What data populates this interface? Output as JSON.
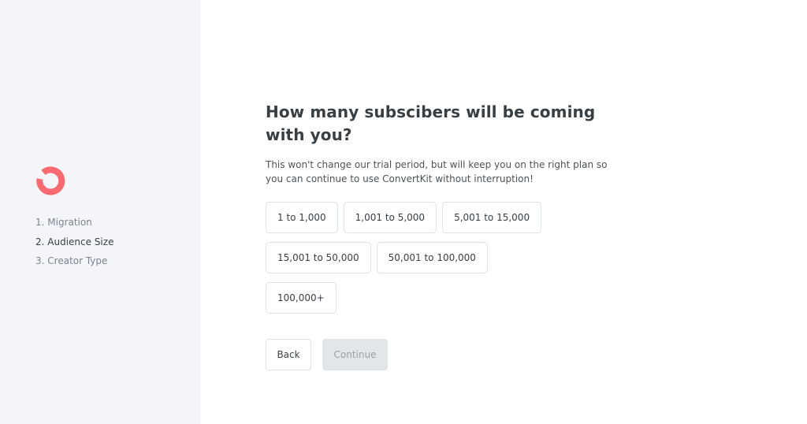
{
  "brand": {
    "logo_icon": "convertkit-logo-icon",
    "accent": "#fb6970"
  },
  "sidebar": {
    "steps": [
      {
        "label": "1. Migration",
        "active": false
      },
      {
        "label": "2. Audience Size",
        "active": true
      },
      {
        "label": "3. Creator Type",
        "active": false
      }
    ]
  },
  "main": {
    "title": "How many subscibers will be coming with you?",
    "subtitle": "This won't change our trial period, but will keep you on the right plan so you can continue to use ConvertKit without interruption!",
    "options": [
      "1 to 1,000",
      "1,001 to 5,000",
      "5,001 to 15,000",
      "15,001 to 50,000",
      "50,001 to 100,000",
      "100,000+"
    ],
    "back_label": "Back",
    "continue_label": "Continue"
  }
}
